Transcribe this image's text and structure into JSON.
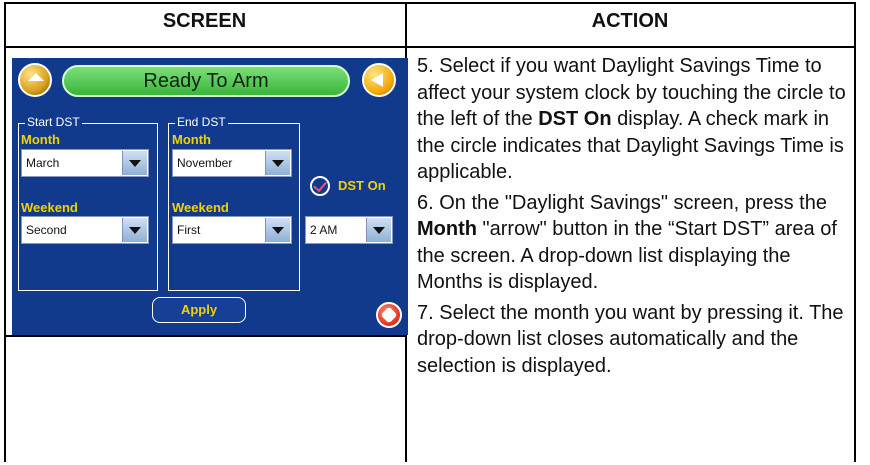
{
  "table": {
    "header_screen": "SCREEN",
    "header_action": "ACTION"
  },
  "device": {
    "title": "Ready To Arm",
    "start_group": "Start DST",
    "end_group": "End DST",
    "month_label": "Month",
    "weekend_label": "Weekend",
    "start_month": "March",
    "start_weekend": "Second",
    "end_month": "November",
    "end_weekend": "First",
    "time": "2 AM",
    "dst_checked": true,
    "dst_label": "DST On",
    "apply_label": "Apply",
    "icons": [
      "home-icon",
      "back-arrow-icon",
      "dropdown-arrow-icon",
      "checkmark-icon",
      "stop-icon"
    ]
  },
  "steps": [
    {
      "pre": "5.  Select if you want Daylight Savings Time to affect your system clock by touching the circle to the left of the ",
      "bold": "DST On",
      "post": " display. A check mark in the circle indicates that Daylight Savings Time is applicable."
    },
    {
      "pre": "6.  On the \"Daylight Savings\" screen, press the ",
      "bold": "Month",
      "post": " \"arrow\" button in the “Start DST” area of the screen.  A drop-down list displaying the Months is displayed."
    },
    {
      "pre": "7.  Select the month you want by pressing it.  The drop-down list closes automatically and the selection is displayed.",
      "bold": "",
      "post": ""
    }
  ]
}
